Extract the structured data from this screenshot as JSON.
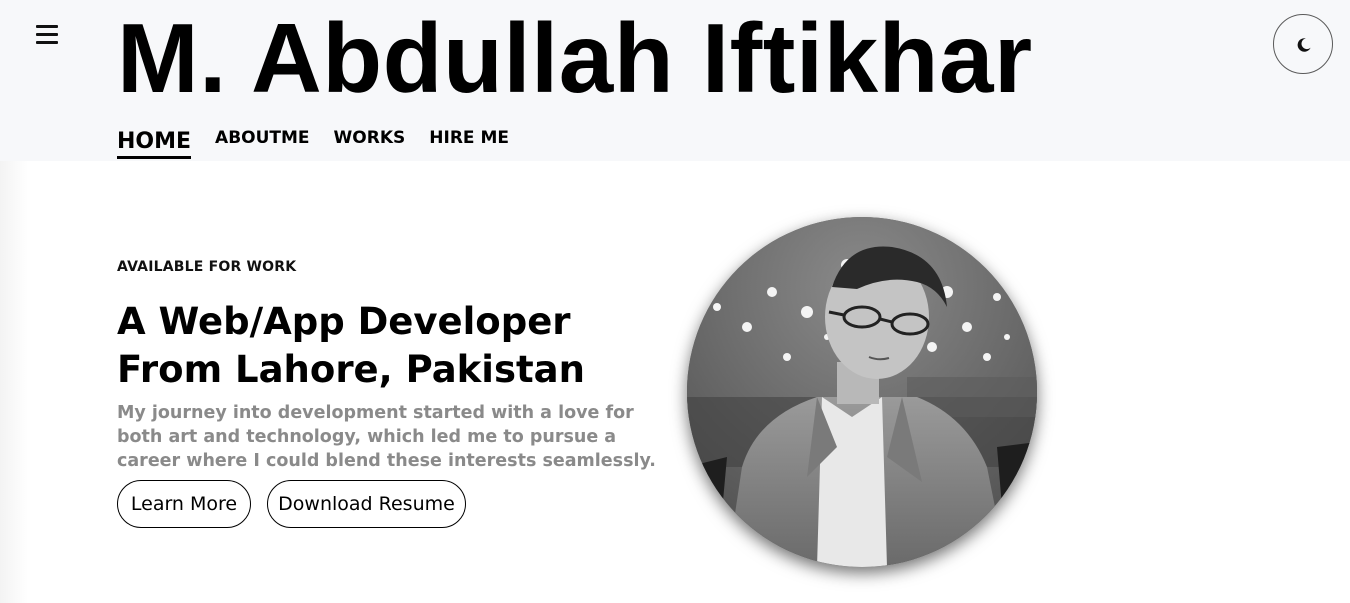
{
  "header": {
    "title": "M. Abdullah Iftikhar",
    "menu_icon": "hamburger-menu-icon",
    "theme_icon": "moon-icon",
    "background": "#f7f8fa"
  },
  "nav": {
    "items": [
      {
        "label": "HOME",
        "active": true
      },
      {
        "label": "ABOUTME",
        "active": false
      },
      {
        "label": "WORKS",
        "active": false
      },
      {
        "label": "HIRE ME",
        "active": false
      }
    ]
  },
  "hero": {
    "eyebrow": "AVAILABLE FOR WORK",
    "headline": "A Web/App Developer From Lahore, Pakistan",
    "description": "My journey into development started with a love for both art and technology, which led me to pursue a career where I could blend these interests seamlessly.",
    "buttons": {
      "learn_more": "Learn More",
      "download_resume": "Download Resume"
    },
    "description_color": "#8a8a8a"
  }
}
